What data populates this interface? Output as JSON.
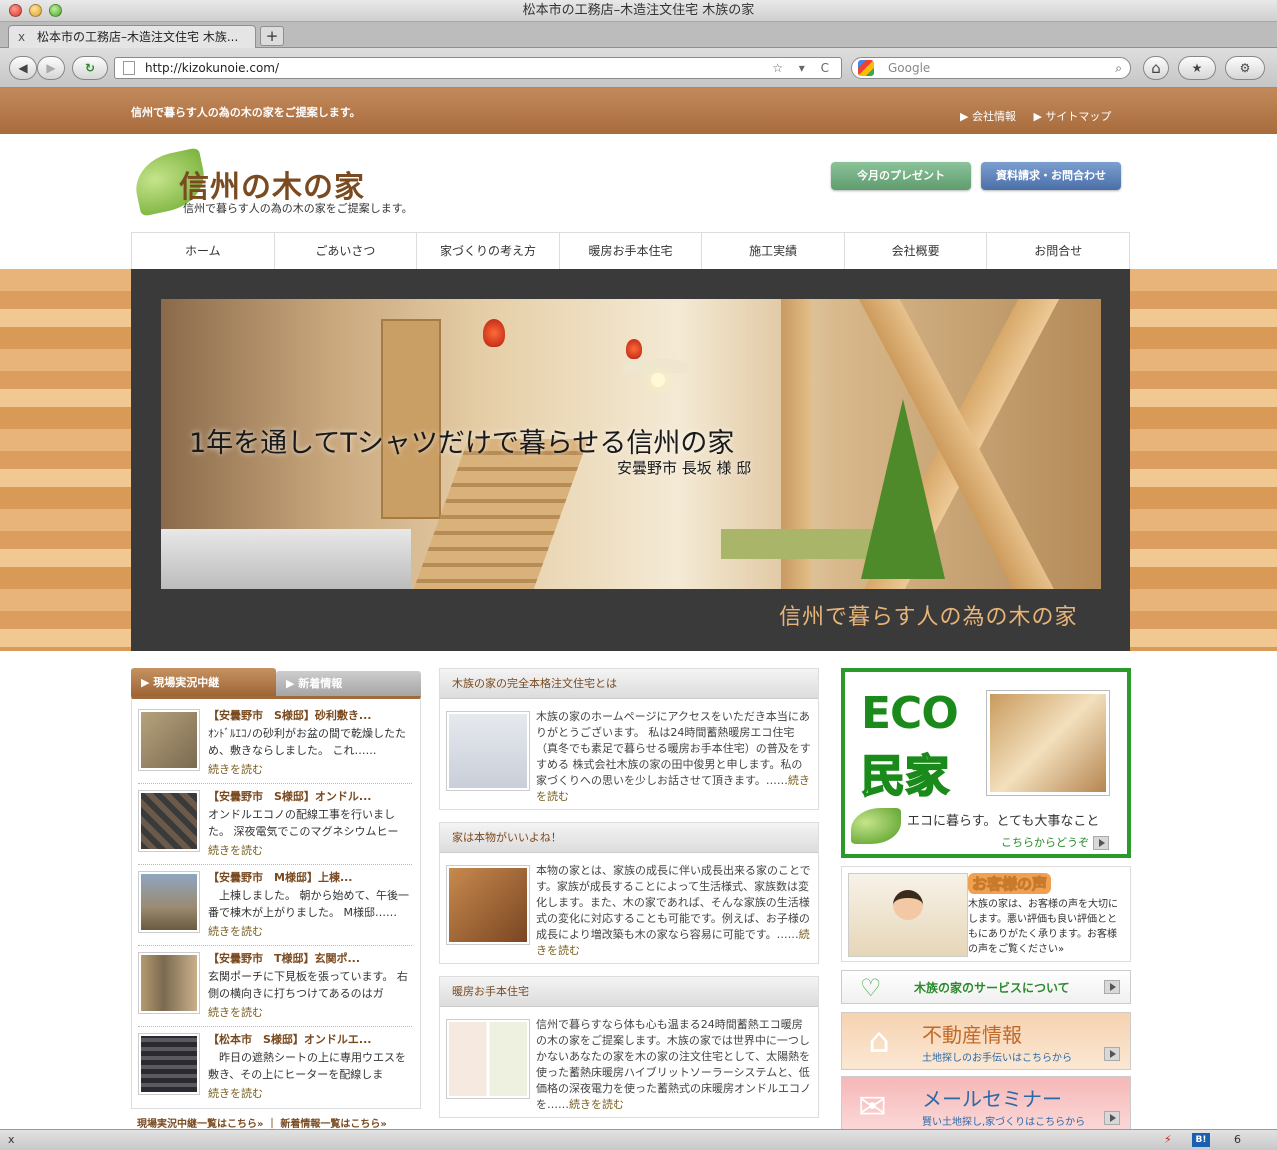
{
  "browser": {
    "window_title": "松本市の工務店–木造注文住宅 木族の家",
    "tab_title": "松本市の工務店–木造注文住宅 木族...",
    "tab_close": "x",
    "new_tab": "+",
    "back": "◀",
    "forward": "▶",
    "reload": "↻",
    "url": "http://kizokunoie.com/",
    "url_tools": "☆ ▾ C",
    "search_placeholder": "Google",
    "search_icon": "⌕",
    "home": "⌂",
    "bookmarks": "★",
    "tools": "⚙"
  },
  "site": {
    "top_tagline": "信州で暮らす人の為の木の家をご提案します。",
    "top_links": [
      "▶ 会社情報",
      "▶ サイトマップ"
    ],
    "logo_title": "信州の木の家",
    "logo_sub": "信州で暮らす人の為の木の家をご提案します。",
    "btn_present": "今月のプレゼント",
    "btn_contact": "資料請求・お問合わせ",
    "nav": [
      "ホーム",
      "ごあいさつ",
      "家づくりの考え方",
      "暖房お手本住宅",
      "施工実績",
      "会社概要",
      "お問合せ"
    ],
    "hero": {
      "caption": "1年を通してTシャツだけで暮らせる信州の家",
      "caption_sub": "安曇野市 長坂 様 邸",
      "slogan": "信州で暮らす人の為の木の家"
    }
  },
  "left": {
    "tab_active": "▶ 現場実況中継",
    "tab_inactive": "▶ 新着情報",
    "entries": [
      {
        "title": "【安曇野市　S様邸】砂利敷き...",
        "body": "ｵﾝﾄﾞﾙｴｺﾉの砂利がお盆の間で乾燥したため、敷きならしました。 これ……",
        "more": "続きを読む",
        "color": "#8a7a60"
      },
      {
        "title": "【安曇野市　S様邸】オンドル...",
        "body": "オンドルエコノの配線工事を行いました。 深夜電気でこのマグネシウムヒータ……",
        "more": "続きを読む",
        "color": "#5a4a3a"
      },
      {
        "title": "【安曇野市　M様邸】上棟...",
        "body": "　上棟しました。 朝から始めて、午後一番で棟木が上がりました。 M様邸……",
        "more": "続きを読む",
        "color": "#6a6a70"
      },
      {
        "title": "【安曇野市　T様邸】玄関ポ...",
        "body": "玄関ポーチに下見板を張っています。 右側の横向きに打ちつけてあるのはガラ……",
        "more": "続きを読む",
        "color": "#7a6a50"
      },
      {
        "title": "【松本市　S様邸】オンドルエ...",
        "body": "　昨日の遮熱シートの上に専用ウエスを敷き、その上にヒーターを配線します……",
        "more": "続きを読む",
        "color": "#4a4a50"
      }
    ],
    "footer": "現場実況中継一覧はこちら» ｜ 新着情報一覧はこちら»"
  },
  "center": {
    "boxes": [
      {
        "head": "木族の家の完全本格注文住宅とは",
        "body": "木族の家のホームページにアクセスをいただき本当にありがとうございます。 私は24時間蓄熱暖房エコ住宅（真冬でも素足で暮らせる暖房お手本住宅）の普及をすすめる 株式会社木族の家の田中俊男と申します。私の家づくりへの思いを少しお話させて頂きます。……",
        "more": "続きを読む",
        "color": "#dfe3ea"
      },
      {
        "head": "家は本物がいいよね！",
        "body": "本物の家とは、家族の成長に伴い成長出来る家のことです。家族が成長することによって生活様式、家族数は変化します。また、木の家であれば、そんな家族の生活様式の変化に対応することも可能です。例えば、お子様の成長により増改築も木の家なら容易に可能です。……",
        "more": "続きを読む",
        "color": "#a86a38"
      },
      {
        "head": "暖房お手本住宅",
        "body": "信州で暮らすなら体も心も温まる24時間蓄熱エコ暖房の木の家をご提案します。木族の家では世界中に一つしかないあなたの家を木の家の注文住宅として、太陽熱を使った蓄熱床暖房ハイブリットソーラーシステムと、低価格の深夜電力を使った蓄熱式の床暖房オンドルエコノを……",
        "more": "続きを読む",
        "color": "#f1ece0"
      }
    ]
  },
  "right": {
    "eco_word": "ECO",
    "eco_kanji": "民家",
    "eco_tag": "エコに暮らす。とても大事なこと",
    "eco_link": "こちらからどうぞ",
    "voice_title": "お客様の声",
    "voice_body": "木族の家は、お客様の声を大切にします。悪い評価も良い評価とともにありがたく承ります。お客様の声をご覧ください»",
    "service": "木族の家のサービスについて",
    "re_title": "不動産情報",
    "re_sub": "土地探しのお手伝いはこちらから",
    "mail_title": "メールセミナー",
    "mail_sub": "賢い土地探し,家づくりはこちらから"
  },
  "status": {
    "close": "x",
    "bolt": "⚡",
    "hatena": "B!",
    "count": "6"
  }
}
